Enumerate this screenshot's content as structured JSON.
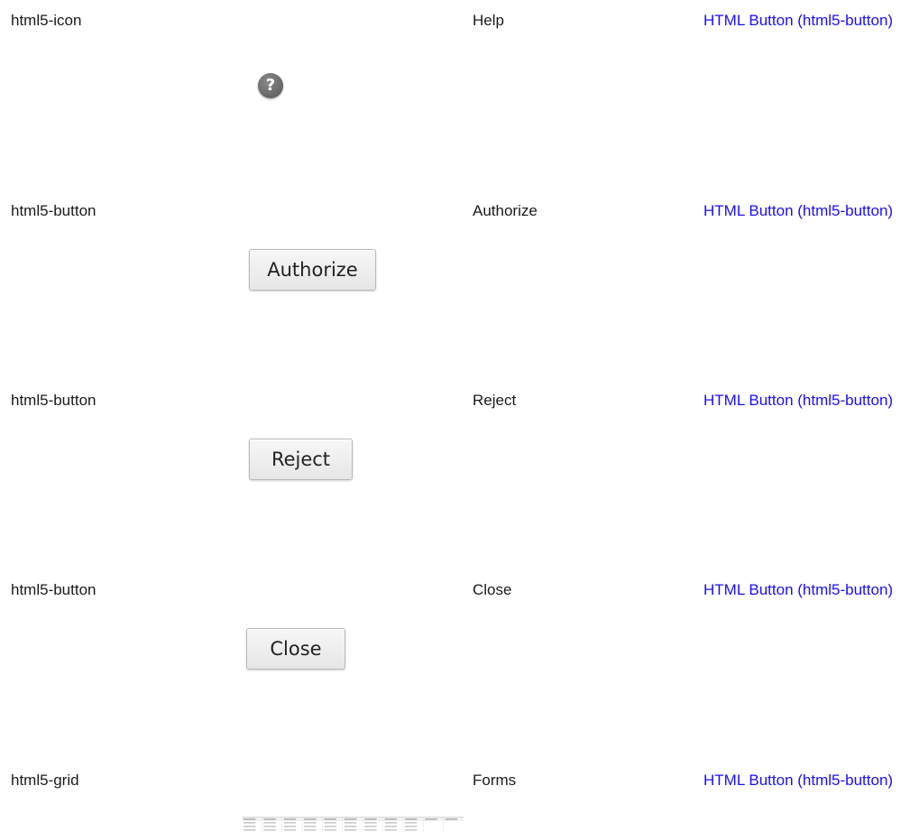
{
  "rows": [
    {
      "component_type": "html5-icon",
      "label": "Help",
      "link": "HTML Button (html5-button)",
      "preview_icon": "help-icon",
      "icon_glyph": "?"
    },
    {
      "component_type": "html5-button",
      "label": "Authorize",
      "link": "HTML Button (html5-button)",
      "preview_button": "Authorize"
    },
    {
      "component_type": "html5-button",
      "label": "Reject",
      "link": "HTML Button (html5-button)",
      "preview_button": "Reject"
    },
    {
      "component_type": "html5-button",
      "label": "Close",
      "link": "HTML Button (html5-button)",
      "preview_button": "Close"
    },
    {
      "component_type": "html5-grid",
      "label": "Forms",
      "link": "HTML Button (html5-button)",
      "preview_grid": {
        "columns": [
          "Function Application",
          "Form Name",
          "Access Right Defined",
          "Access Rights Flow",
          "Operations",
          "Created By",
          "Created Date",
          "Last Saved By",
          "Last Saved Date",
          "Checked By",
          "Checked Date"
        ]
      }
    }
  ],
  "colors": {
    "link": "#1a0dff",
    "text": "#1a1a1a",
    "button_border": "#b9b9b9",
    "icon_background": "#666666"
  }
}
